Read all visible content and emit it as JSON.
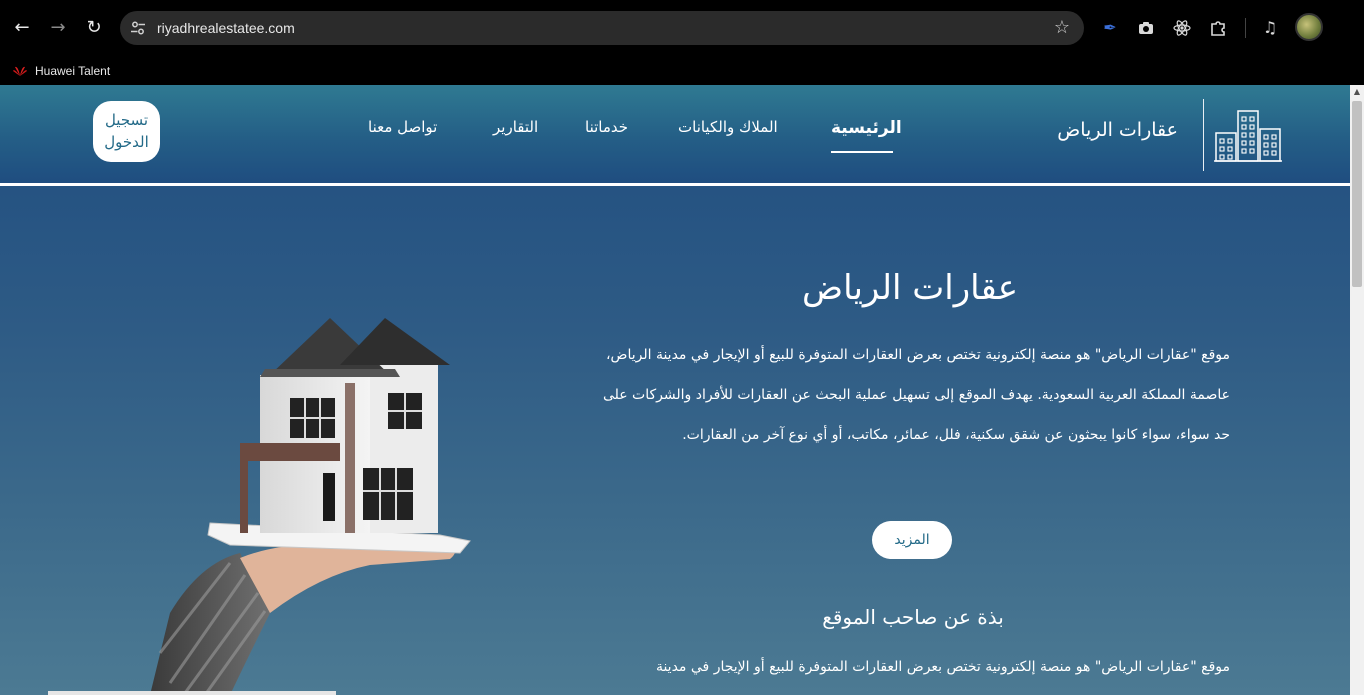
{
  "browser": {
    "url": "riyadhrealestatee.com",
    "bookmark_label": "Huawei Talent"
  },
  "site": {
    "brand_name": "عقارات الرياض",
    "nav": {
      "home": "الرئيسية",
      "properties": "الملاك والكيانات",
      "services": "خدماتنا",
      "reports": "التقارير",
      "contact": "تواصل معنا"
    },
    "login_label": "تسجيل الدخول"
  },
  "hero": {
    "title": "عقارات الرياض",
    "description": "موقع \"عقارات الرياض\" هو منصة إلكترونية تختص بعرض العقارات المتوفرة للبيع أو الإيجار في مدينة الرياض، عاصمة المملكة العربية السعودية. يهدف الموقع إلى تسهيل عملية البحث عن العقارات للأفراد والشركات على حد سواء، سواء كانوا يبحثون عن شقق سكنية، فلل، عمائر، مكاتب، أو أي نوع آخر من العقارات.",
    "more_button": "المزيد"
  },
  "about": {
    "title": "بذة عن صاحب الموقع",
    "description": "موقع \"عقارات الرياض\" هو منصة إلكترونية تختص بعرض العقارات المتوفرة للبيع أو الإيجار في مدينة"
  },
  "colors": {
    "header_top": "#2f7a92",
    "hero_bg": "#2e5b85",
    "accent_text": "#236a88"
  },
  "icons": [
    "back-arrow-icon",
    "forward-arrow-icon",
    "reload-icon",
    "site-settings-icon",
    "star-icon",
    "pen-extension-icon",
    "camera-extension-icon",
    "react-extension-icon",
    "puzzle-extensions-icon",
    "media-control-icon",
    "buildings-logo-icon"
  ]
}
